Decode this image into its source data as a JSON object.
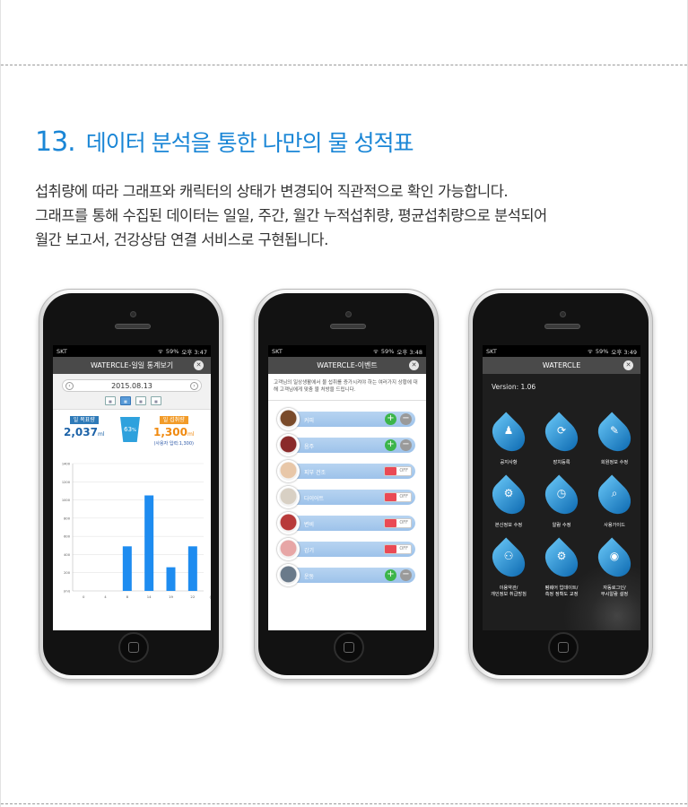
{
  "section": {
    "number": "13.",
    "title": "데이터 분석을 통한 나만의 물 성적표",
    "desc": [
      "섭취량에 따라 그래프와 캐릭터의 상태가 변경되어 직관적으로 확인 가능합니다.",
      "그래프를 통해 수집된 데이터는 일일, 주간, 월간 누적섭취량, 평균섭취량으로 분석되어",
      "월간 보고서, 건강상담 연결 서비스로 구현됩니다."
    ]
  },
  "phones": [
    {
      "status": {
        "carrier": "SKT",
        "battery": "59%",
        "time": "오후 3:47"
      },
      "title": "WATERCLE-일일 통계보기",
      "date": "2015.08.13",
      "goal_label": "일 목표량",
      "goal_value": "2,037",
      "goal_unit": "ml",
      "cup_percent": "63",
      "cup_unit": "%",
      "intake_label": "일 섭취량",
      "intake_value": "1,300",
      "intake_unit": "ml",
      "intake_note": "(사용자 입력:1,300)"
    },
    {
      "status": {
        "carrier": "SKT",
        "battery": "59%",
        "time": "오후 3:48"
      },
      "title": "WATERCLE-이벤트",
      "intro": "고객님의 일상생활에서 물 섭취를 증가시켜야 하는 여러가지 상황에 대해 고객님에게 맞춤 물 처방을 드립니다.",
      "events": [
        {
          "name": "커피",
          "control": "plusminus",
          "color": "#7a4b2a"
        },
        {
          "name": "음주",
          "control": "plusminus",
          "color": "#8a2a2a"
        },
        {
          "name": "피부 건조",
          "control": "toggle",
          "state": "off",
          "color": "#e8c7a8"
        },
        {
          "name": "다이어트",
          "control": "toggle",
          "state": "off",
          "color": "#d8d0c4"
        },
        {
          "name": "변비",
          "control": "toggle",
          "state": "off",
          "color": "#b83a3a"
        },
        {
          "name": "감기",
          "control": "toggle",
          "state": "off",
          "color": "#e7a6a6"
        },
        {
          "name": "운동",
          "control": "plusminus",
          "color": "#6a7a8a"
        }
      ],
      "toggle_label": "OFF"
    },
    {
      "status": {
        "carrier": "SKT",
        "battery": "59%",
        "time": "오후 3:49"
      },
      "title": "WATERCLE",
      "version": "Version: 1.06",
      "menu": [
        {
          "label": "공지사항",
          "icon": "notice-icon",
          "glyph": "♟"
        },
        {
          "label": "장치등록",
          "icon": "sync-icon",
          "glyph": "⟳"
        },
        {
          "label": "회원정보 수정",
          "icon": "edit-icon",
          "glyph": "✎"
        },
        {
          "label": "본신정보 수정",
          "icon": "settings-icon",
          "glyph": "⚙"
        },
        {
          "label": "알람 수정",
          "icon": "clock-icon",
          "glyph": "◷"
        },
        {
          "label": "사용가이드",
          "icon": "guide-icon",
          "glyph": "⌕"
        },
        {
          "label": "이용약관/\n개인정보 취급방침",
          "icon": "terms-icon",
          "glyph": "⚇"
        },
        {
          "label": "펌웨어 업데이트/\n측정 정확도 교정",
          "icon": "firmware-icon",
          "glyph": "⚙"
        },
        {
          "label": "자동로그인/\n무시알람 설정",
          "icon": "login-icon",
          "glyph": "◉"
        }
      ]
    }
  ],
  "chart_data": {
    "type": "bar",
    "categories": [
      "0",
      "4",
      "8",
      "14",
      "19",
      "22"
    ],
    "x_ticks": [
      "0",
      "4",
      "8",
      "14",
      "19",
      "22",
      "(시)"
    ],
    "values": [
      0,
      0,
      490,
      1050,
      260,
      490
    ],
    "y_ticks": [
      "1400",
      "1200",
      "1000",
      "800",
      "600",
      "400",
      "200",
      "(ml)"
    ],
    "ylim": [
      0,
      1400
    ],
    "color": "#1e8cf0",
    "grid": true
  }
}
